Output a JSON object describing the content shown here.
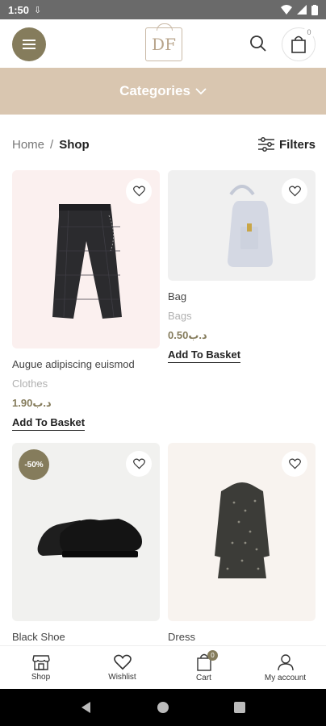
{
  "status_bar": {
    "time": "1:50"
  },
  "header": {
    "logo_text": "DF",
    "cart_count": "0"
  },
  "categories": {
    "label": "Categories"
  },
  "breadcrumb": {
    "home": "Home",
    "separator": "/",
    "current": "Shop"
  },
  "filters": {
    "label": "Filters"
  },
  "products": [
    {
      "name": "Augue adipiscing euismod",
      "category": "Clothes",
      "price": "1.90د.ب",
      "add_label": "Add To Basket"
    },
    {
      "name": "Bag",
      "category": "Bags",
      "price": "0.50د.ب",
      "add_label": "Add To Basket"
    },
    {
      "name": "Black Shoe",
      "sale_badge": "-50%"
    },
    {
      "name": "Dress"
    }
  ],
  "bottom_nav": {
    "shop": "Shop",
    "wishlist": "Wishlist",
    "cart": "Cart",
    "cart_badge": "0",
    "account": "My account"
  },
  "colors": {
    "accent": "#857c5c",
    "categories_bg": "#d9c6b0",
    "price": "#857c5c"
  }
}
